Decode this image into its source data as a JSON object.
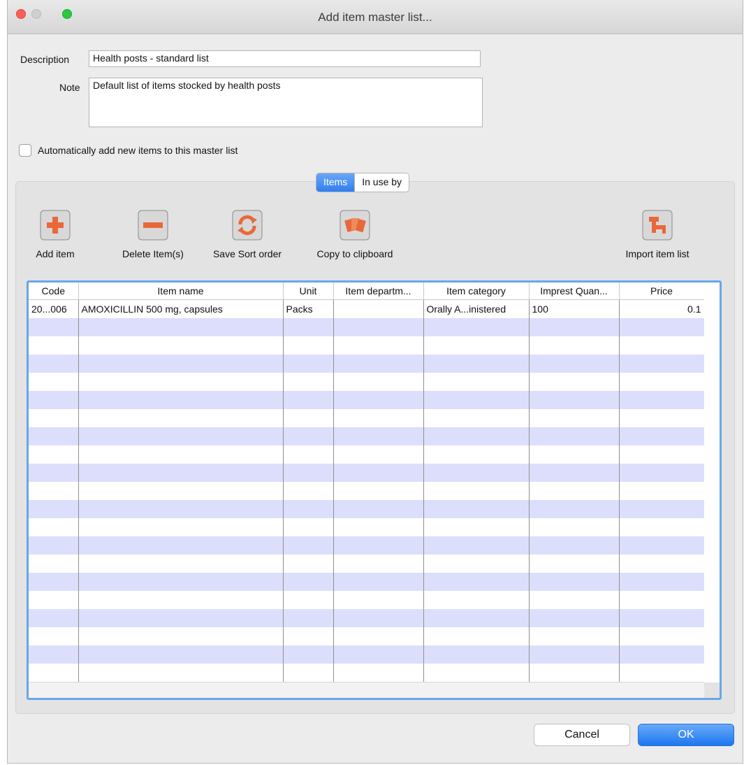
{
  "window": {
    "title": "Add item master list..."
  },
  "form": {
    "description_label": "Description",
    "description_value": "Health posts - standard list",
    "note_label": "Note",
    "note_value": "Default list of items stocked by health posts",
    "auto_add_label": "Automatically add new items to this master list",
    "auto_add_checked": false
  },
  "tabs": [
    {
      "label": "Items",
      "selected": true
    },
    {
      "label": "In use by",
      "selected": false
    }
  ],
  "toolbar": {
    "add_item": "Add item",
    "delete_items": "Delete Item(s)",
    "save_sort_order": "Save Sort order",
    "copy_to_clipboard": "Copy to clipboard",
    "import_item_list": "Import item list"
  },
  "table": {
    "columns": [
      "Code",
      "Item name",
      "Unit",
      "Item departm...",
      "Item category",
      "Imprest Quan...",
      "Price"
    ],
    "rows": [
      [
        "20...006",
        "AMOXICILLIN 500 mg, capsules",
        "Packs",
        "",
        "Orally A...inistered",
        "100",
        "0.1"
      ]
    ]
  },
  "buttons": {
    "cancel": "Cancel",
    "ok": "OK"
  },
  "colors": {
    "accent": "#2f7ef0",
    "row_stripe": "#dcdffb",
    "icon_orange": "#e8683a"
  }
}
